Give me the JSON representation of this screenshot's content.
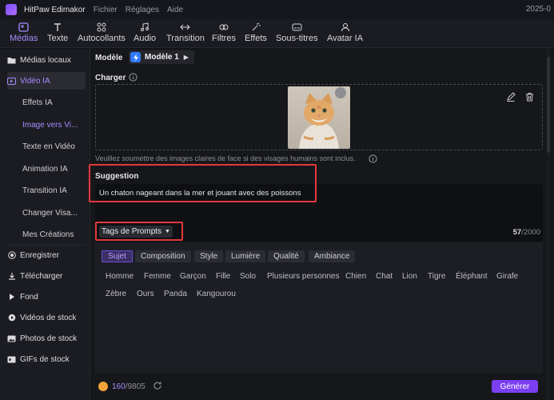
{
  "app": {
    "title": "HitPaw Edimakor",
    "menu": [
      "Fichier",
      "Réglages",
      "Aide"
    ],
    "date": "2025-0"
  },
  "toolbar": {
    "tabs": [
      {
        "label": "Médias",
        "icon": "media-icon"
      },
      {
        "label": "Texte",
        "icon": "text-icon"
      },
      {
        "label": "Autocollants",
        "icon": "sticker-icon"
      },
      {
        "label": "Audio",
        "icon": "audio-icon"
      },
      {
        "label": "Transition",
        "icon": "transition-icon"
      },
      {
        "label": "Filtres",
        "icon": "filter-icon"
      },
      {
        "label": "Effets",
        "icon": "effects-icon"
      },
      {
        "label": "Sous-titres",
        "icon": "subtitles-icon"
      },
      {
        "label": "Avatar IA",
        "icon": "avatar-icon"
      }
    ]
  },
  "sidebar": {
    "local_media": "Médias locaux",
    "ai_video": "Vidéo IA",
    "sub": [
      "Effets IA",
      "Image vers Vi...",
      "Texte en Vidéo",
      "Animation IA",
      "Transition IA",
      "Changer Visa...",
      "Mes Créations"
    ],
    "record": "Enregistrer",
    "download": "Télécharger",
    "background": "Fond",
    "stock_video": "Vidéos de stock",
    "stock_photo": "Photos de stock",
    "gif": "GIFs de stock"
  },
  "model": {
    "label": "Modèle",
    "value": "Modèle 1"
  },
  "upload": {
    "label": "Charger",
    "hint": "Veuillez soumettre des images claires de face si des visages humains sont inclus."
  },
  "prompt": {
    "label": "Suggestion",
    "text": "Un chaton nageant dans la mer et jouant avec des poissons",
    "tags_button": "Tags de Prompts",
    "count": "57",
    "max": "/2000"
  },
  "categories": [
    "Sujet",
    "Composition",
    "Style",
    "Lumière",
    "Qualité",
    "Ambiance"
  ],
  "tags_row1": [
    "Homme",
    "Femme",
    "Garçon",
    "Fille",
    "Solo",
    "Plusieurs personnes",
    "Chien",
    "Chat",
    "Lion",
    "Tigre",
    "Éléphant",
    "Girafe"
  ],
  "tags_row2": [
    "Zèbre",
    "Ours",
    "Panda",
    "Kangourou"
  ],
  "footer": {
    "credits_used": "160",
    "credits_total": "/9805",
    "generate": "Générer"
  },
  "colors": {
    "accent": "#a98bff",
    "generate": "#7b3ff2",
    "highlight": "#e23a3a"
  }
}
